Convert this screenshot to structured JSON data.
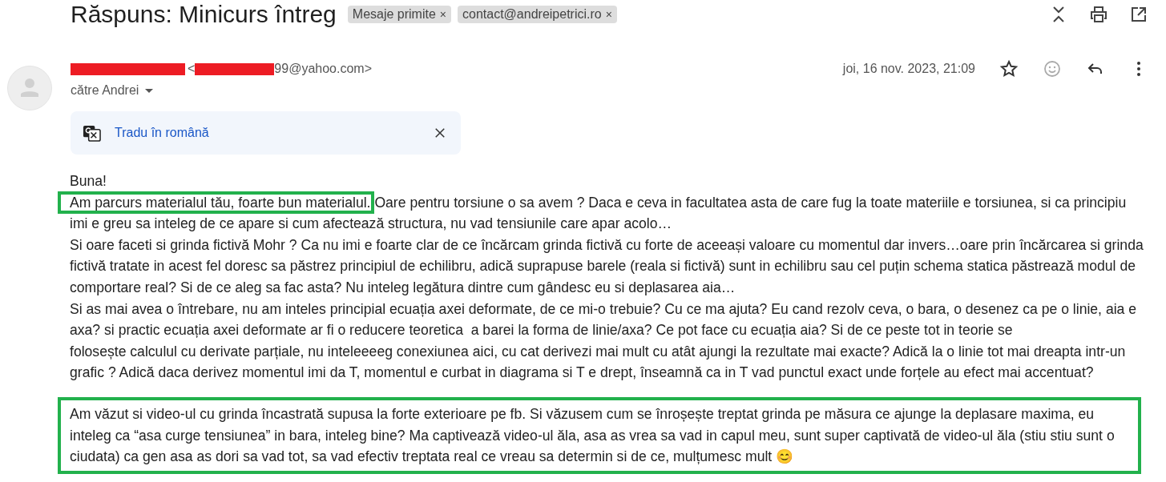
{
  "subject": "Răspuns: Minicurs întreg",
  "labels": [
    {
      "text": "Mesaje primite",
      "remove": "×"
    },
    {
      "text": "contact@andreipetrici.ro",
      "remove": "×"
    }
  ],
  "sender": {
    "email_open": "<",
    "email_tail": "99@yahoo.com>",
    "recipient": "către Andrei",
    "date": "joi, 16 nov. 2023, 21:09",
    "starred": false
  },
  "translate": {
    "label": "Tradu în română"
  },
  "body": [
    {
      "text": "Buna!"
    },
    {
      "highlight": "Am parcurs materialul tău, foarte bun materialul.",
      "text": " Oare pentru torsiune o sa avem ? Daca e ceva in facultatea asta de care fug la toate materiile e torsiunea, si ca principiu imi e greu sa inteleg de ce apare si cum afectează structura, nu vad tensiunile care apar acolo…"
    },
    {
      "text": "Si oare faceti si grinda fictivă Mohr ? Ca nu imi e foarte clar de ce încărcam grinda fictivă cu forte de aceeași valoare cu momentul dar invers…oare prin încărcarea si grinda fictivă tratate in acest fel doresc sa păstrez principiul de echilibru, adică suprapuse barele (reala si fictivă) sunt in echilibru sau cel puțin schema statica păstrează modul de comportare real? Si de ce aleg sa fac asta? Nu inteleg legătura dintre cum gândesc eu si deplasarea aia…"
    },
    {
      "text": "Si as mai avea o întrebare, nu am inteles principial ecuația axei deformate, de ce mi-o trebuie? Cu ce ma ajuta? Eu cand rezolv ceva, o bara, o desenez ca pe o linie, aia e axa? si practic ecuația axei deformate ar fi o reducere teoretica  a barei la forma de linie/axa? Ce pot face cu ecuația aia? Si de ce peste tot in teorie se"
    },
    {
      "text": "folosește calculul cu derivate parțiale, nu inteleeeeg conexiunea aici, cu cat derivezi mai mult cu atât ajungi la rezultate mai exacte? Adică la o linie tot mai dreapta intr-un grafic ? Adică daca derivez momentul imi da T, momentul e curbat in diagrama si T e drept, înseamnă ca in T vad punctul exact unde forțele au efect mai accentuat?"
    }
  ],
  "highlighted_block": {
    "highlighted": true,
    "text": "Am văzut si video-ul cu grinda încastrată supusa la forte exterioare pe fb. Si văzusem cum se înroșește treptat grinda pe măsura ce ajunge la deplasare maxima, eu inteleg ca “asa curge tensiunea” in bara, inteleg bine? Ma captivează video-ul ăla, asa as vrea sa vad in capul meu, sunt super captivată de video-ul ăla (stiu stiu sunt o ciudata) ca gen asa as dori sa vad tot, sa vad efectiv treptata real ce vreau sa determin si de ce, mulțumesc mult 😊"
  }
}
